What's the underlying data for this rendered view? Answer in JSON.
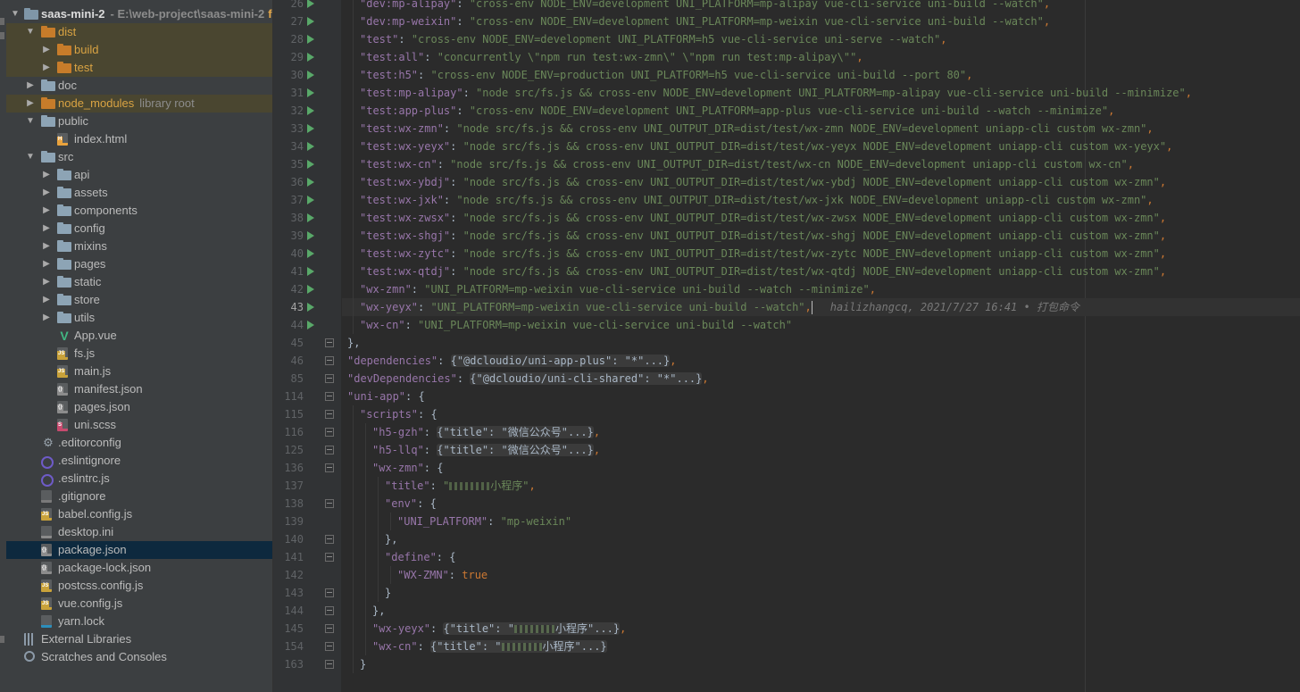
{
  "project_tree": {
    "root": {
      "name": "saas-mini-2",
      "path": "E:\\web-project\\saas-mini-2",
      "branch_hint": "fe"
    },
    "items": [
      {
        "label": "dist",
        "type": "folder",
        "depth": 1,
        "expanded": true,
        "excluded": true
      },
      {
        "label": "build",
        "type": "folder",
        "depth": 2,
        "expanded": false,
        "excluded": true
      },
      {
        "label": "test",
        "type": "folder",
        "depth": 2,
        "expanded": false,
        "excluded": true
      },
      {
        "label": "doc",
        "type": "folder",
        "depth": 1,
        "expanded": false
      },
      {
        "label": "node_modules",
        "hint": "library root",
        "type": "folder",
        "depth": 1,
        "expanded": false,
        "excluded": true
      },
      {
        "label": "public",
        "type": "folder",
        "depth": 1,
        "expanded": true
      },
      {
        "label": "index.html",
        "type": "html",
        "depth": 2
      },
      {
        "label": "src",
        "type": "folder",
        "depth": 1,
        "expanded": true
      },
      {
        "label": "api",
        "type": "folder",
        "depth": 2,
        "expanded": false
      },
      {
        "label": "assets",
        "type": "folder",
        "depth": 2,
        "expanded": false
      },
      {
        "label": "components",
        "type": "folder",
        "depth": 2,
        "expanded": false
      },
      {
        "label": "config",
        "type": "folder",
        "depth": 2,
        "expanded": false
      },
      {
        "label": "mixins",
        "type": "folder",
        "depth": 2,
        "expanded": false
      },
      {
        "label": "pages",
        "type": "folder",
        "depth": 2,
        "expanded": false
      },
      {
        "label": "static",
        "type": "folder",
        "depth": 2,
        "expanded": false
      },
      {
        "label": "store",
        "type": "folder",
        "depth": 2,
        "expanded": false
      },
      {
        "label": "utils",
        "type": "folder",
        "depth": 2,
        "expanded": false
      },
      {
        "label": "App.vue",
        "type": "vue",
        "depth": 2
      },
      {
        "label": "fs.js",
        "type": "js",
        "depth": 2
      },
      {
        "label": "main.js",
        "type": "js",
        "depth": 2
      },
      {
        "label": "manifest.json",
        "type": "json",
        "depth": 2
      },
      {
        "label": "pages.json",
        "type": "json",
        "depth": 2
      },
      {
        "label": "uni.scss",
        "type": "scss",
        "depth": 2
      },
      {
        "label": ".editorconfig",
        "type": "gear",
        "depth": 1
      },
      {
        "label": ".eslintignore",
        "type": "eslint",
        "depth": 1
      },
      {
        "label": ".eslintrc.js",
        "type": "eslint",
        "depth": 1
      },
      {
        "label": ".gitignore",
        "type": "git",
        "depth": 1
      },
      {
        "label": "babel.config.js",
        "type": "js",
        "depth": 1
      },
      {
        "label": "desktop.ini",
        "type": "text",
        "depth": 1
      },
      {
        "label": "package.json",
        "type": "json",
        "depth": 1,
        "selected": true
      },
      {
        "label": "package-lock.json",
        "type": "json",
        "depth": 1
      },
      {
        "label": "postcss.config.js",
        "type": "js",
        "depth": 1
      },
      {
        "label": "vue.config.js",
        "type": "js",
        "depth": 1
      },
      {
        "label": "yarn.lock",
        "type": "yarn",
        "depth": 1
      },
      {
        "label": "External Libraries",
        "type": "libs",
        "depth": 0
      },
      {
        "label": "Scratches and Consoles",
        "type": "scratch",
        "depth": 0
      }
    ]
  },
  "editor": {
    "current_line": "43",
    "blame": {
      "author": "hailizhangcq",
      "date": "2021/7/27 16:41",
      "separator": "•",
      "message": "打包命令"
    },
    "lines": [
      {
        "no": "26",
        "run": true,
        "depth": 2,
        "key": "\"dev:mp-alipay\"",
        "value": "\"cross-env NODE_ENV=development UNI_PLATFORM=mp-alipay vue-cli-service uni-build --watch\"",
        "end": ","
      },
      {
        "no": "27",
        "run": true,
        "depth": 2,
        "key": "\"dev:mp-weixin\"",
        "value": "\"cross-env NODE_ENV=development UNI_PLATFORM=mp-weixin vue-cli-service uni-build --watch\"",
        "end": ","
      },
      {
        "no": "28",
        "run": true,
        "depth": 2,
        "key": "\"test\"",
        "value": "\"cross-env NODE_ENV=development UNI_PLATFORM=h5 vue-cli-service uni-serve --watch\"",
        "end": ","
      },
      {
        "no": "29",
        "run": true,
        "depth": 2,
        "key": "\"test:all\"",
        "value": "\"concurrently \\\"npm run test:wx-zmn\\\" \\\"npm run test:mp-alipay\\\"\"",
        "end": ","
      },
      {
        "no": "30",
        "run": true,
        "depth": 2,
        "key": "\"test:h5\"",
        "value": "\"cross-env NODE_ENV=production UNI_PLATFORM=h5 vue-cli-service uni-build --port 80\"",
        "end": ","
      },
      {
        "no": "31",
        "run": true,
        "depth": 2,
        "key": "\"test:mp-alipay\"",
        "value": "\"node src/fs.js && cross-env NODE_ENV=development UNI_PLATFORM=mp-alipay vue-cli-service uni-build --minimize\"",
        "end": ","
      },
      {
        "no": "32",
        "run": true,
        "depth": 2,
        "key": "\"test:app-plus\"",
        "value": "\"cross-env NODE_ENV=development UNI_PLATFORM=app-plus vue-cli-service uni-build --watch --minimize\"",
        "end": ","
      },
      {
        "no": "33",
        "run": true,
        "depth": 2,
        "key": "\"test:wx-zmn\"",
        "value": "\"node src/fs.js && cross-env UNI_OUTPUT_DIR=dist/test/wx-zmn NODE_ENV=development uniapp-cli custom wx-zmn\"",
        "end": ","
      },
      {
        "no": "34",
        "run": true,
        "depth": 2,
        "key": "\"test:wx-yeyx\"",
        "value": "\"node src/fs.js && cross-env UNI_OUTPUT_DIR=dist/test/wx-yeyx NODE_ENV=development uniapp-cli custom wx-yeyx\"",
        "end": ","
      },
      {
        "no": "35",
        "run": true,
        "depth": 2,
        "key": "\"test:wx-cn\"",
        "value": "\"node src/fs.js && cross-env UNI_OUTPUT_DIR=dist/test/wx-cn NODE_ENV=development uniapp-cli custom wx-cn\"",
        "end": ","
      },
      {
        "no": "36",
        "run": true,
        "depth": 2,
        "key": "\"test:wx-ybdj\"",
        "value": "\"node src/fs.js && cross-env UNI_OUTPUT_DIR=dist/test/wx-ybdj NODE_ENV=development uniapp-cli custom wx-zmn\"",
        "end": ","
      },
      {
        "no": "37",
        "run": true,
        "depth": 2,
        "key": "\"test:wx-jxk\"",
        "value": "\"node src/fs.js && cross-env UNI_OUTPUT_DIR=dist/test/wx-jxk NODE_ENV=development uniapp-cli custom wx-zmn\"",
        "end": ","
      },
      {
        "no": "38",
        "run": true,
        "depth": 2,
        "key": "\"test:wx-zwsx\"",
        "value": "\"node src/fs.js && cross-env UNI_OUTPUT_DIR=dist/test/wx-zwsx NODE_ENV=development uniapp-cli custom wx-zmn\"",
        "end": ","
      },
      {
        "no": "39",
        "run": true,
        "depth": 2,
        "key": "\"test:wx-shgj\"",
        "value": "\"node src/fs.js && cross-env UNI_OUTPUT_DIR=dist/test/wx-shgj NODE_ENV=development uniapp-cli custom wx-zmn\"",
        "end": ","
      },
      {
        "no": "40",
        "run": true,
        "depth": 2,
        "key": "\"test:wx-zytc\"",
        "value": "\"node src/fs.js && cross-env UNI_OUTPUT_DIR=dist/test/wx-zytc NODE_ENV=development uniapp-cli custom wx-zmn\"",
        "end": ","
      },
      {
        "no": "41",
        "run": true,
        "depth": 2,
        "key": "\"test:wx-qtdj\"",
        "value": "\"node src/fs.js && cross-env UNI_OUTPUT_DIR=dist/test/wx-qtdj NODE_ENV=development uniapp-cli custom wx-zmn\"",
        "end": ","
      },
      {
        "no": "42",
        "run": true,
        "depth": 2,
        "key": "\"wx-zmn\"",
        "value": "\"UNI_PLATFORM=mp-weixin vue-cli-service uni-build --watch --minimize\"",
        "end": ","
      },
      {
        "no": "43",
        "run": true,
        "depth": 2,
        "key": "\"wx-yeyx\"",
        "value": "\"UNI_PLATFORM=mp-weixin vue-cli-service uni-build --watch\"",
        "end": ",",
        "current": true
      },
      {
        "no": "44",
        "run": true,
        "depth": 2,
        "key": "\"wx-cn\"",
        "value": "\"UNI_PLATFORM=mp-weixin vue-cli-service uni-build --watch\"",
        "end": ""
      },
      {
        "no": "45",
        "fold": true,
        "depth": 1,
        "raw": "},"
      },
      {
        "no": "46",
        "fold": true,
        "depth": 1,
        "key": "\"dependencies\"",
        "folded": "{\"@dcloudio/uni-app-plus\": \"*\"...}",
        "end": ","
      },
      {
        "no": "85",
        "fold": true,
        "depth": 1,
        "key": "\"devDependencies\"",
        "folded": "{\"@dcloudio/uni-cli-shared\": \"*\"...}",
        "end": ","
      },
      {
        "no": "114",
        "fold": true,
        "depth": 1,
        "key": "\"uni-app\"",
        "open": "{"
      },
      {
        "no": "115",
        "fold": true,
        "depth": 2,
        "key": "\"scripts\"",
        "open": "{"
      },
      {
        "no": "116",
        "fold": true,
        "depth": 3,
        "key": "\"h5-gzh\"",
        "folded": "{\"title\": \"微信公众号\"...}",
        "end": ","
      },
      {
        "no": "125",
        "fold": true,
        "depth": 3,
        "key": "\"h5-llq\"",
        "folded": "{\"title\": \"微信公众号\"...}",
        "end": ","
      },
      {
        "no": "136",
        "fold": true,
        "depth": 3,
        "key": "\"wx-zmn\"",
        "open": "{"
      },
      {
        "no": "137",
        "depth": 4,
        "key": "\"title\"",
        "value": "\"",
        "redacted": true,
        "value_tail": "小程序\"",
        "end": ","
      },
      {
        "no": "138",
        "fold": true,
        "depth": 4,
        "key": "\"env\"",
        "open": "{"
      },
      {
        "no": "139",
        "depth": 5,
        "key": "\"UNI_PLATFORM\"",
        "value": "\"mp-weixin\"",
        "end": ""
      },
      {
        "no": "140",
        "fold": true,
        "depth": 4,
        "raw": "},"
      },
      {
        "no": "141",
        "fold": true,
        "depth": 4,
        "key": "\"define\"",
        "open": "{"
      },
      {
        "no": "142",
        "depth": 5,
        "key": "\"WX-ZMN\"",
        "bool": "true",
        "end": ""
      },
      {
        "no": "143",
        "fold": true,
        "depth": 4,
        "raw": "}"
      },
      {
        "no": "144",
        "fold": true,
        "depth": 3,
        "raw": "},"
      },
      {
        "no": "145",
        "fold": true,
        "depth": 3,
        "key": "\"wx-yeyx\"",
        "folded": "{\"title\": \"",
        "redacted": true,
        "folded_tail": "小程序\"...}",
        "end": ","
      },
      {
        "no": "154",
        "fold": true,
        "depth": 3,
        "key": "\"wx-cn\"",
        "folded": "{\"title\": \"",
        "redacted": true,
        "folded_tail": "小程序\"...}",
        "end": ""
      },
      {
        "no": "163",
        "fold": true,
        "depth": 2,
        "raw": "}"
      }
    ]
  },
  "colors": {
    "background": "#2b2b2b",
    "gutter": "#313335",
    "tree": "#3c3f41",
    "selected_row": "#0d293e",
    "json_key": "#9876aa",
    "json_string": "#6a8759",
    "punctuation": "#cc7832",
    "run_icon": "#59a869"
  }
}
